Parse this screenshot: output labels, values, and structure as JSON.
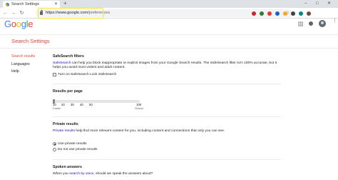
{
  "browser": {
    "tab_title": "Search Settings",
    "url_host": "https://www.google.com/",
    "url_path": "preferences",
    "window_controls": [
      "–",
      "□",
      "✕"
    ],
    "extension_colors": [
      "#c62828",
      "#2e7d32",
      "#e53935",
      "#1565c0",
      "#f9a825",
      "#424242",
      "#00897b",
      "#6d4c41"
    ]
  },
  "header": {
    "logo_letters": [
      {
        "ch": "G",
        "color": "#4285f4"
      },
      {
        "ch": "o",
        "color": "#ea4335"
      },
      {
        "ch": "o",
        "color": "#fbbc05"
      },
      {
        "ch": "g",
        "color": "#4285f4"
      },
      {
        "ch": "l",
        "color": "#34a853"
      },
      {
        "ch": "e",
        "color": "#ea4335"
      }
    ],
    "page_title": "Search Settings"
  },
  "sidebar": {
    "items": [
      {
        "label": "Search results",
        "active": true
      },
      {
        "label": "Languages",
        "active": false
      },
      {
        "label": "Help",
        "active": false
      }
    ]
  },
  "safesearch": {
    "title": "SafeSearch filters",
    "desc_link": "SafeSearch",
    "desc_text": " can help you block inappropriate or explicit images from your Google Search results. The SafeSearch filter isn't 100% accurate, but it helps you avoid most violent and adult content.",
    "checkbox_label": "Turn on SafeSearch",
    "checked": false,
    "lock_link": "Lock SafeSearch"
  },
  "results_per_page": {
    "title": "Results per page",
    "ticks": [
      "10",
      "20",
      "30",
      "40",
      "50",
      "100"
    ],
    "selected_value": 10,
    "faster_label": "Faster",
    "slower_label": "Slower"
  },
  "private_results": {
    "title": "Private results",
    "desc_link": "Private results",
    "desc_text": " help find more relevant content for you, including content and connections that only you can see.",
    "options": [
      {
        "label": "Use private results",
        "selected": true
      },
      {
        "label": "Do not use private results",
        "selected": false
      }
    ]
  },
  "spoken_answers": {
    "title": "Spoken answers",
    "desc_pre": "When you ",
    "desc_link": "search by voice",
    "desc_post": ", should we speak the answers aloud?"
  }
}
